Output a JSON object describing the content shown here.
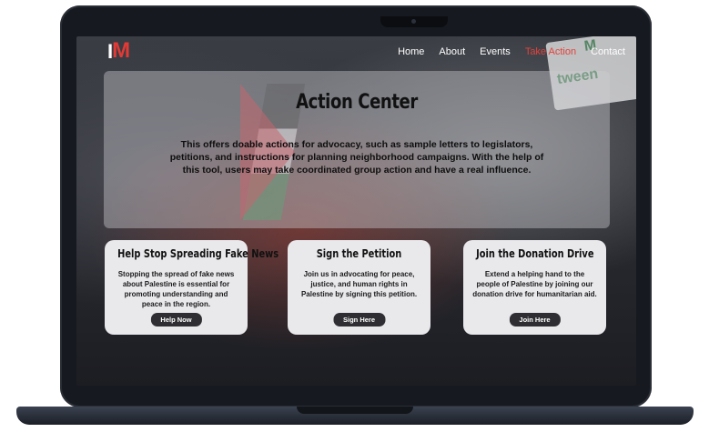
{
  "nav": {
    "logo_prefix": "I",
    "logo_mark": "M",
    "links": [
      "Home",
      "About",
      "Events",
      "Take Action",
      "Contact"
    ],
    "active_link": "Take Action",
    "accent_color": "#e2433c"
  },
  "background": {
    "sign_text_main": "tween",
    "sign_text_top": "M"
  },
  "hero": {
    "title": "Action Center",
    "text": "This offers doable actions for advocacy, such as sample letters to legislators, petitions, and instructions for planning neighborhood campaigns. With the help of this tool, users may take coordinated group action and have a real influence."
  },
  "cards": [
    {
      "title": "Help Stop Spreading Fake News",
      "text": "Stopping the spread of fake news about Palestine is essential for promoting understanding and peace in the region.",
      "button": "Help Now"
    },
    {
      "title": "Sign the Petition",
      "text": "Join us in advocating for peace, justice, and human rights in Palestine by signing this petition.",
      "button": "Sign Here"
    },
    {
      "title": "Join the Donation Drive",
      "text": "Extend a helping hand to the people of Palestine by joining our donation drive for humanitarian aid.",
      "button": "Join Here"
    }
  ]
}
